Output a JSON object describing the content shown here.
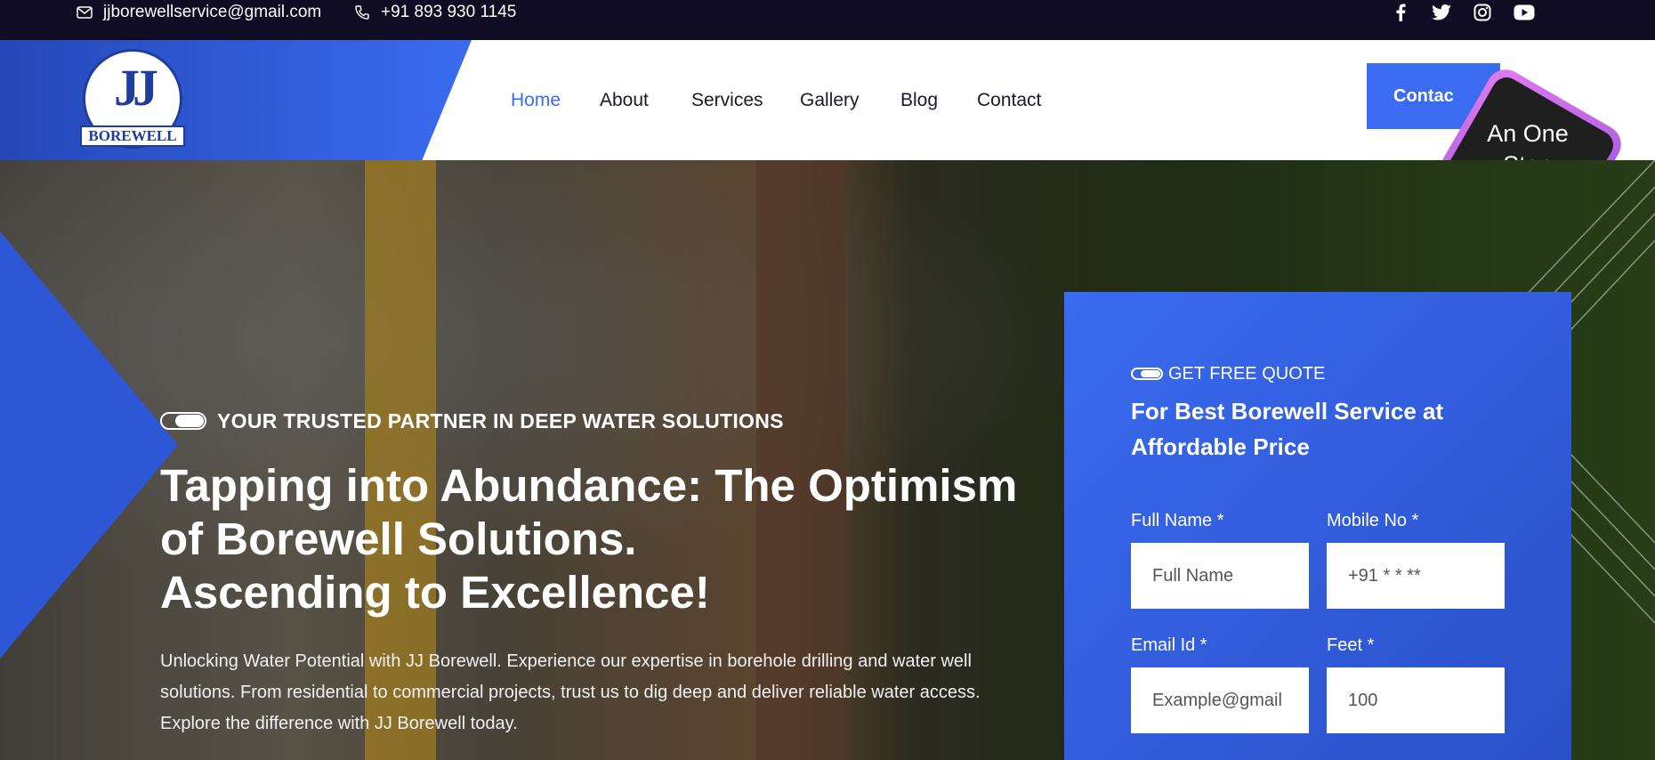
{
  "topbar": {
    "email": "jjborewellservice@gmail.com",
    "phone": "+91 893 930 1145",
    "social_icons": [
      "facebook-icon",
      "twitter-icon",
      "instagram-icon",
      "youtube-icon"
    ]
  },
  "logo": {
    "monogram": "JJ",
    "wordmark": "BOREWELL"
  },
  "nav": {
    "items": [
      {
        "label": "Home",
        "active": true
      },
      {
        "label": "About"
      },
      {
        "label": "Services"
      },
      {
        "label": "Gallery"
      },
      {
        "label": "Blog"
      },
      {
        "label": "Contact"
      }
    ]
  },
  "header": {
    "cta_label": "Contac",
    "badge_text": "An One Stop Solution"
  },
  "hero": {
    "tagline": "YOUR TRUSTED PARTNER IN DEEP WATER SOLUTIONS",
    "headline_line1": "Tapping into Abundance: The Optimism",
    "headline_line2": "of Borewell Solutions.",
    "headline_line3": "Ascending to Excellence!",
    "description": "Unlocking Water Potential with JJ Borewell. Experience our expertise in borehole drilling and water well solutions. From residential to commercial projects, trust us to dig deep and deliver reliable water access. Explore the difference with JJ Borewell today."
  },
  "quote": {
    "tag": "GET FREE QUOTE",
    "title": "For Best Borewell Service at Affordable Price",
    "full_name_label": "Full Name *",
    "full_name_placeholder": "Full Name",
    "mobile_label": "Mobile No *",
    "mobile_placeholder": "+91 * * **",
    "email_label": "Email Id *",
    "email_placeholder": "Example@gmail",
    "feet_label": "Feet *",
    "feet_placeholder": "100"
  },
  "colors": {
    "accent": "#3a6bf0",
    "topbar": "#0f0c24",
    "badge_gradient": "#e27cf0"
  }
}
